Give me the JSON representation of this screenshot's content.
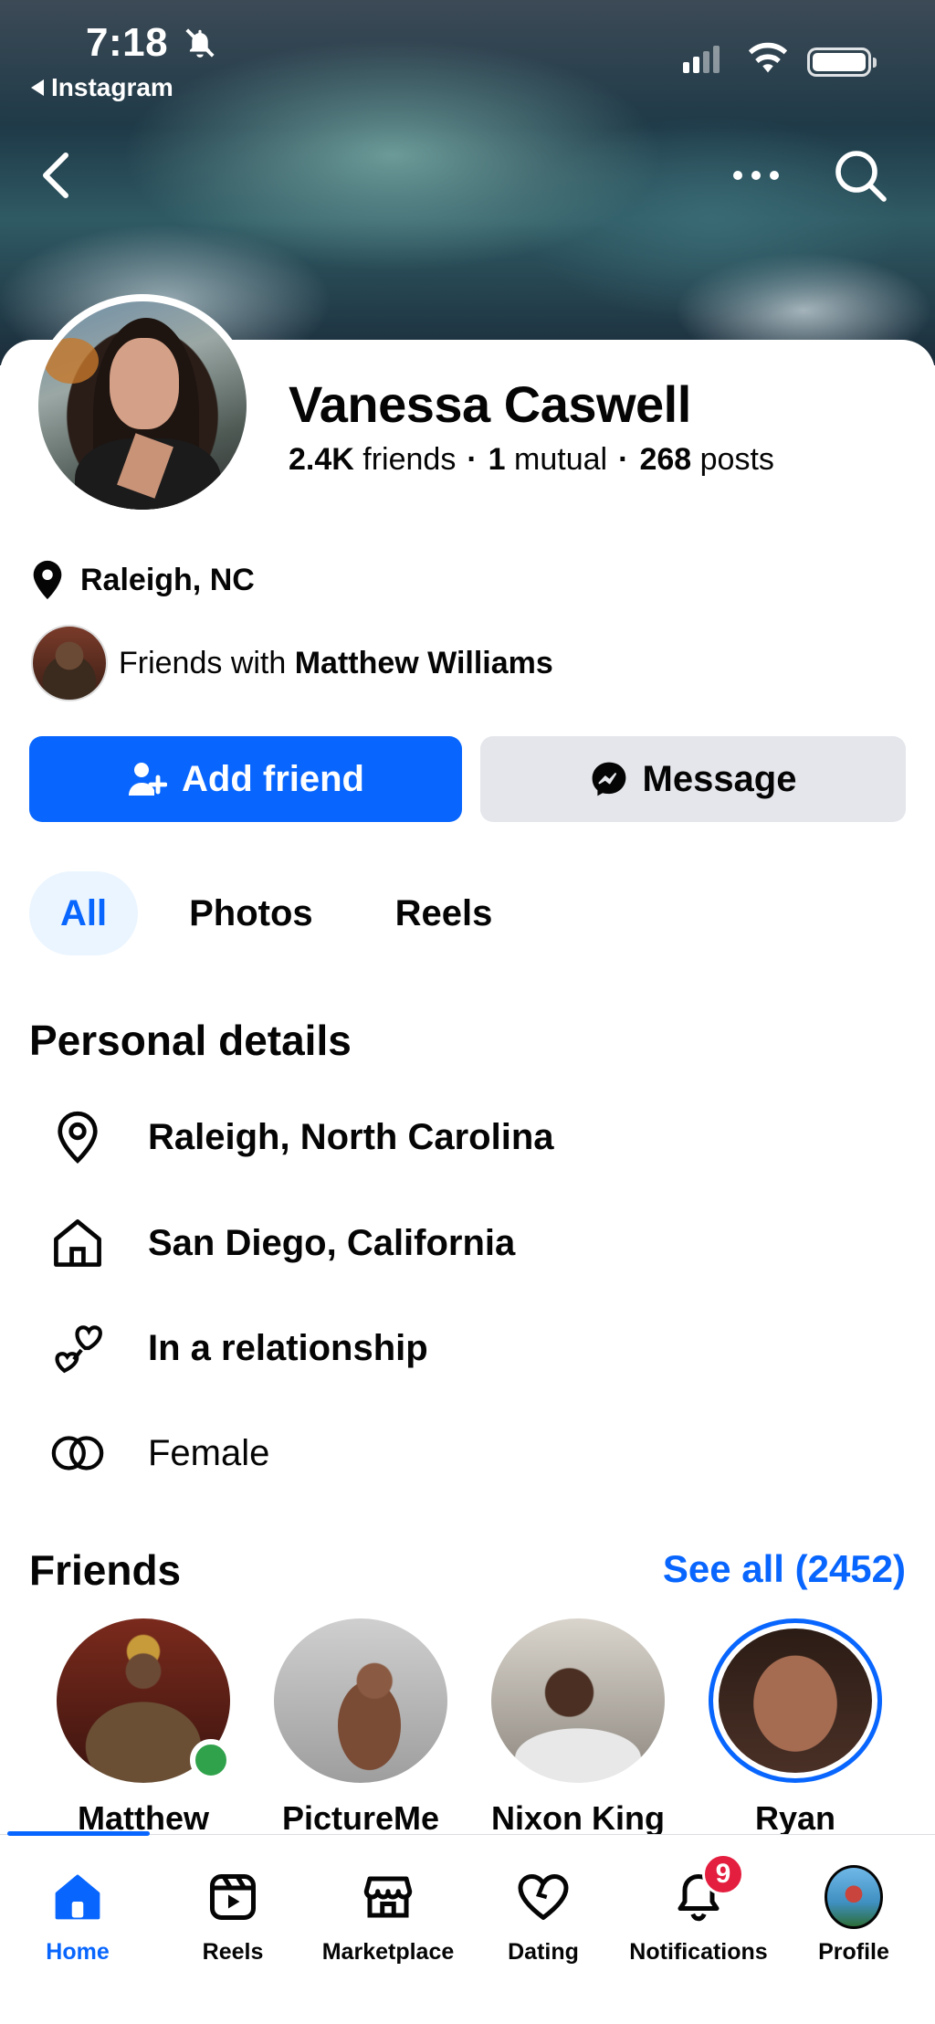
{
  "status_bar": {
    "time": "7:18",
    "back_app": "Instagram"
  },
  "profile": {
    "name": "Vanessa Caswell",
    "friends_count": "2.4K",
    "friends_label": "friends",
    "mutual_count": "1",
    "mutual_label": "mutual",
    "posts_count": "268",
    "posts_label": "posts",
    "location": "Raleigh, NC",
    "friends_with_prefix": "Friends with",
    "friends_with_name": "Matthew Williams"
  },
  "actions": {
    "add_friend": "Add friend",
    "message": "Message"
  },
  "tabs": [
    {
      "label": "All",
      "active": true
    },
    {
      "label": "Photos",
      "active": false
    },
    {
      "label": "Reels",
      "active": false
    }
  ],
  "personal_details": {
    "title": "Personal details",
    "items": [
      {
        "icon": "location-pin-icon",
        "text": "Raleigh, North Carolina"
      },
      {
        "icon": "home-icon",
        "text": "San Diego, California"
      },
      {
        "icon": "hearts-icon",
        "text": "In a relationship"
      },
      {
        "icon": "gender-rings-icon",
        "text": "Female"
      }
    ]
  },
  "friends_section": {
    "title": "Friends",
    "see_all": "See all (2452)",
    "items": [
      {
        "name": "Matthew",
        "online": true
      },
      {
        "name": "PictureMe",
        "online": false
      },
      {
        "name": "Nixon King",
        "online": false
      },
      {
        "name": "Ryan",
        "online": false
      }
    ]
  },
  "bottom_nav": {
    "items": [
      {
        "label": "Home",
        "icon": "home-icon",
        "active": true
      },
      {
        "label": "Reels",
        "icon": "reels-icon",
        "active": false
      },
      {
        "label": "Marketplace",
        "icon": "marketplace-icon",
        "active": false
      },
      {
        "label": "Dating",
        "icon": "dating-heart-icon",
        "active": false
      },
      {
        "label": "Notifications",
        "icon": "bell-icon",
        "active": false,
        "badge": "9"
      },
      {
        "label": "Profile",
        "icon": "profile-avatar",
        "active": false
      }
    ]
  },
  "colors": {
    "accent": "#0866ff",
    "button_secondary": "#e4e6eb",
    "tab_active_bg": "#ebf5ff",
    "online": "#31a24c",
    "badge": "#e41e3f"
  }
}
